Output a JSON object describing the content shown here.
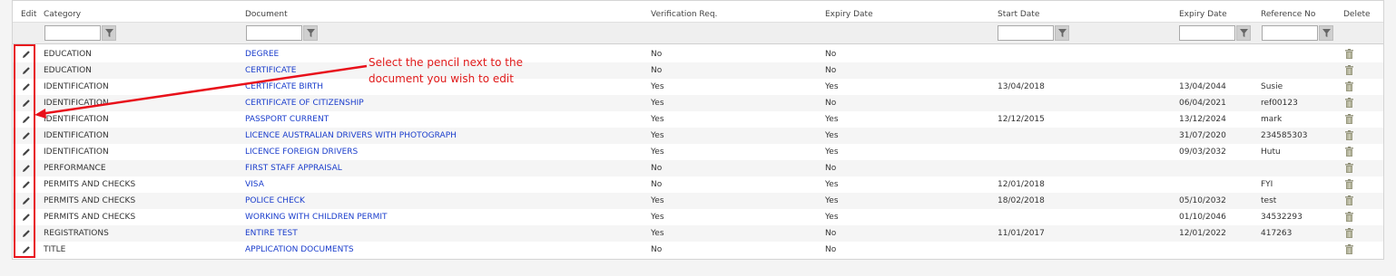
{
  "headers": {
    "edit": "Edit",
    "category": "Category",
    "document": "Document",
    "verification": "Verification Req.",
    "expiry_flag": "Expiry Date",
    "start_date": "Start Date",
    "expiry_date": "Expiry Date",
    "reference": "Reference No",
    "delete": "Delete"
  },
  "filters": {
    "category": "",
    "document": "",
    "start_date": "",
    "expiry_date": "",
    "reference": ""
  },
  "rows": [
    {
      "category": "EDUCATION",
      "document": "DEGREE",
      "verification": "No",
      "expiry_flag": "No",
      "start_date": "",
      "expiry_date": "",
      "reference": ""
    },
    {
      "category": "EDUCATION",
      "document": "CERTIFICATE",
      "verification": "No",
      "expiry_flag": "No",
      "start_date": "",
      "expiry_date": "",
      "reference": ""
    },
    {
      "category": "IDENTIFICATION",
      "document": "CERTIFICATE BIRTH",
      "verification": "Yes",
      "expiry_flag": "Yes",
      "start_date": "13/04/2018",
      "expiry_date": "13/04/2044",
      "reference": "Susie"
    },
    {
      "category": "IDENTIFICATION",
      "document": "CERTIFICATE OF CITIZENSHIP",
      "verification": "Yes",
      "expiry_flag": "No",
      "start_date": "",
      "expiry_date": "06/04/2021",
      "reference": "ref00123"
    },
    {
      "category": "IDENTIFICATION",
      "document": "PASSPORT CURRENT",
      "verification": "Yes",
      "expiry_flag": "Yes",
      "start_date": "12/12/2015",
      "expiry_date": "13/12/2024",
      "reference": "mark"
    },
    {
      "category": "IDENTIFICATION",
      "document": "LICENCE AUSTRALIAN DRIVERS WITH PHOTOGRAPH",
      "verification": "Yes",
      "expiry_flag": "Yes",
      "start_date": "",
      "expiry_date": "31/07/2020",
      "reference": "234585303"
    },
    {
      "category": "IDENTIFICATION",
      "document": "LICENCE FOREIGN DRIVERS",
      "verification": "Yes",
      "expiry_flag": "Yes",
      "start_date": "",
      "expiry_date": "09/03/2032",
      "reference": "Hutu"
    },
    {
      "category": "PERFORMANCE",
      "document": "FIRST STAFF APPRAISAL",
      "verification": "No",
      "expiry_flag": "No",
      "start_date": "",
      "expiry_date": "",
      "reference": ""
    },
    {
      "category": "PERMITS AND CHECKS",
      "document": "VISA",
      "verification": "No",
      "expiry_flag": "Yes",
      "start_date": "12/01/2018",
      "expiry_date": "",
      "reference": "FYI"
    },
    {
      "category": "PERMITS AND CHECKS",
      "document": "POLICE CHECK",
      "verification": "Yes",
      "expiry_flag": "Yes",
      "start_date": "18/02/2018",
      "expiry_date": "05/10/2032",
      "reference": "test"
    },
    {
      "category": "PERMITS AND CHECKS",
      "document": "WORKING WITH CHILDREN PERMIT",
      "verification": "Yes",
      "expiry_flag": "Yes",
      "start_date": "",
      "expiry_date": "01/10/2046",
      "reference": "34532293"
    },
    {
      "category": "REGISTRATIONS",
      "document": "ENTIRE TEST",
      "verification": "Yes",
      "expiry_flag": "No",
      "start_date": "11/01/2017",
      "expiry_date": "12/01/2022",
      "reference": "417263"
    },
    {
      "category": "TITLE",
      "document": "APPLICATION DOCUMENTS",
      "verification": "No",
      "expiry_flag": "No",
      "start_date": "",
      "expiry_date": "",
      "reference": ""
    }
  ],
  "callout": {
    "line1": "Select the pencil next to the",
    "line2": "document you wish to edit"
  },
  "icons": {
    "edit": "pencil-icon",
    "delete": "trash-icon",
    "filter": "filter-icon"
  },
  "colors": {
    "link": "#1a3dcc",
    "annotation": "#e8101a"
  }
}
